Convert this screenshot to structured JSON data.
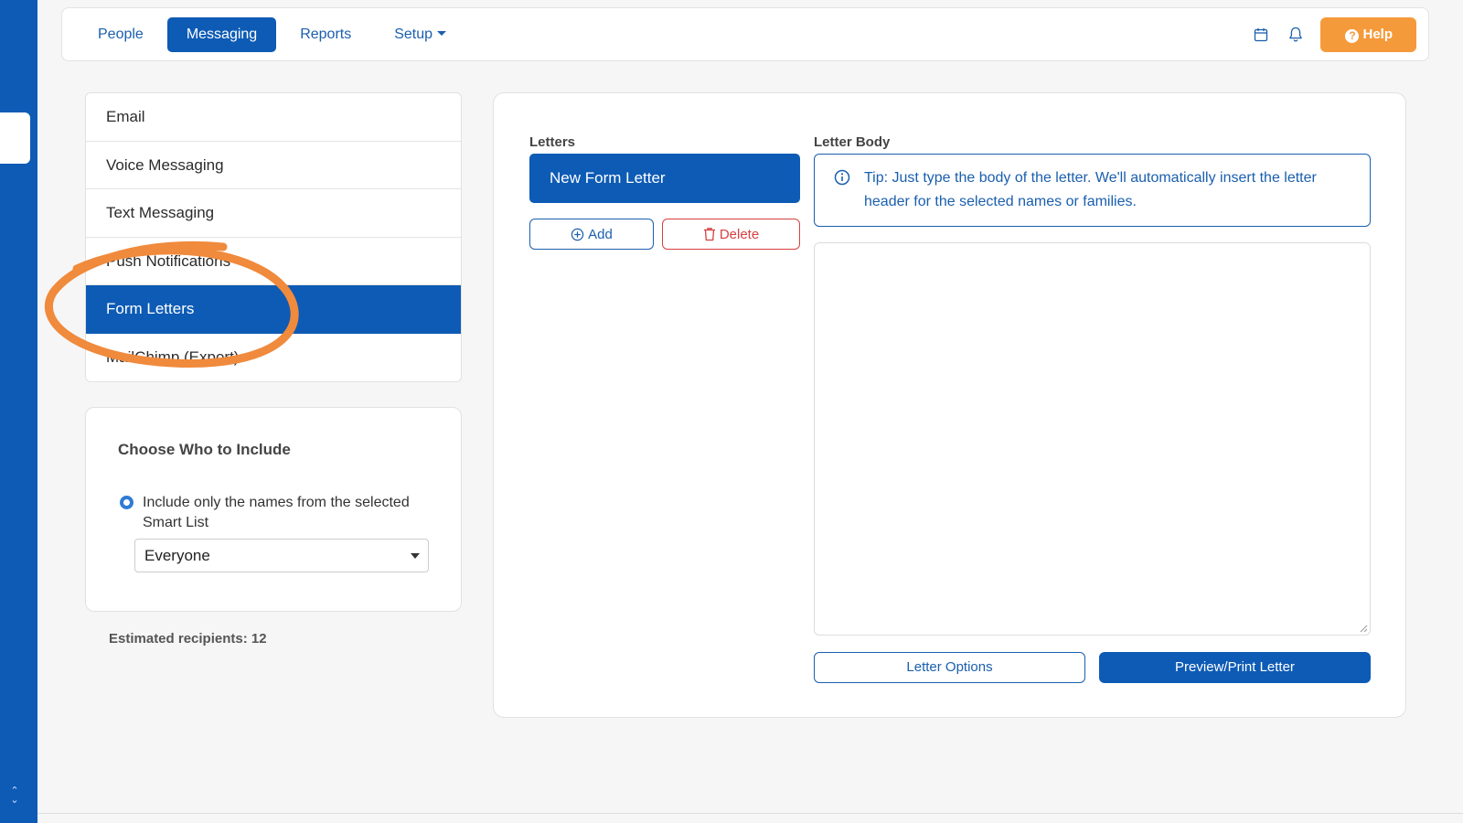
{
  "nav": {
    "items": [
      {
        "label": "People"
      },
      {
        "label": "Messaging",
        "active": true
      },
      {
        "label": "Reports"
      },
      {
        "label": "Setup",
        "dropdown": true
      }
    ],
    "icons": [
      "calendar-icon",
      "bell-icon"
    ],
    "help_label": "Help"
  },
  "sidebar": {
    "items": [
      {
        "label": "Email"
      },
      {
        "label": "Voice Messaging"
      },
      {
        "label": "Text Messaging"
      },
      {
        "label": "Push Notifications"
      },
      {
        "label": "Form Letters",
        "active": true
      },
      {
        "label": "MailChimp (Export)"
      }
    ]
  },
  "include": {
    "title": "Choose Who to Include",
    "radio_label": "Include only the names from the selected Smart List",
    "select_value": "Everyone"
  },
  "estimated": "Estimated recipients: 12",
  "letters": {
    "label": "Letters",
    "items": [
      "New Form Letter"
    ],
    "add_label": "Add",
    "delete_label": "Delete"
  },
  "letter_body": {
    "label": "Letter Body",
    "tip": "Tip: Just type the body of the letter. We'll automatically insert the letter header for the selected names or families.",
    "text": ""
  },
  "buttons": {
    "options": "Letter Options",
    "preview": "Preview/Print Letter"
  },
  "colors": {
    "primary": "#0d5bb5",
    "help": "#f59a3a",
    "danger": "#d64040",
    "annotation": "#f08a3c"
  }
}
